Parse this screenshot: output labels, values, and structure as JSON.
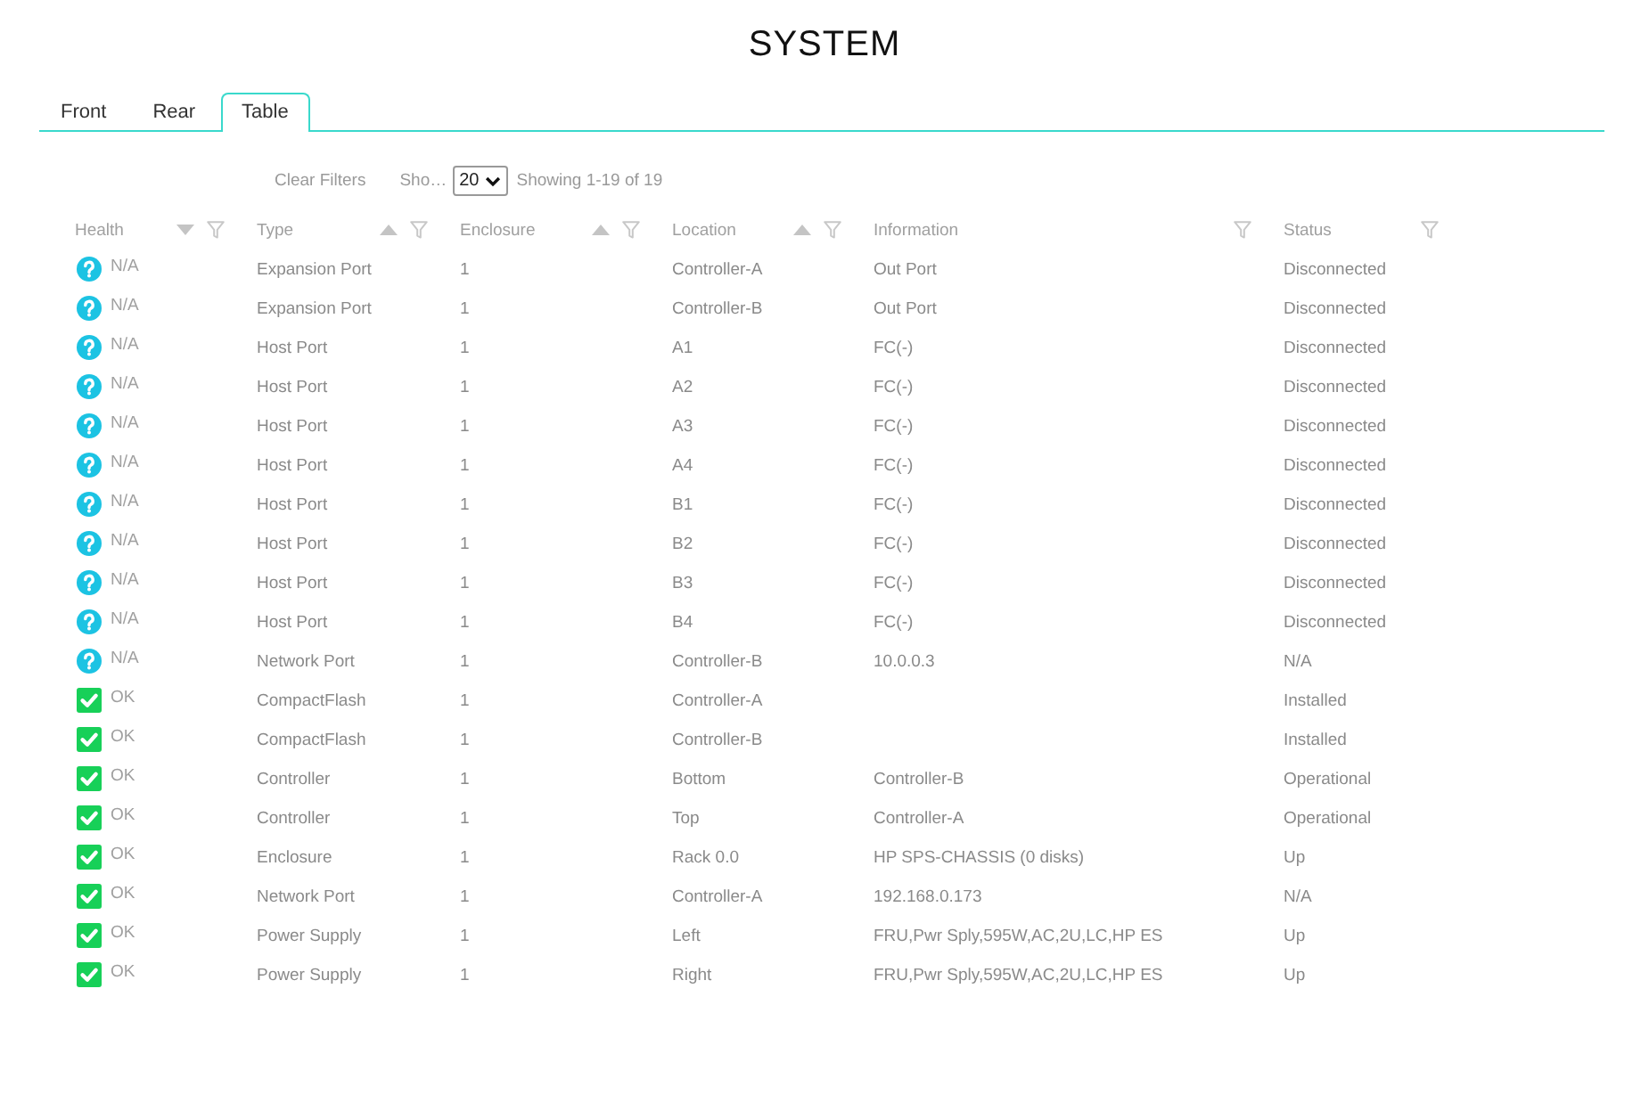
{
  "title": "SYSTEM",
  "tabs": [
    {
      "label": "Front",
      "selected": false
    },
    {
      "label": "Rear",
      "selected": false
    },
    {
      "label": "Table",
      "selected": true
    }
  ],
  "toolbar": {
    "clear_filters": {
      "label": "Clear Filters",
      "disabled": true
    },
    "page_size_label": "Sho…",
    "page_size": "20",
    "showing": "Showing 1-19 of 19"
  },
  "table": {
    "columns": [
      {
        "label": "Health",
        "sortable": true,
        "descending": true
      },
      {
        "label": "Type",
        "sortable": true,
        "descending": false
      },
      {
        "label": "Enclosure",
        "sortable": true,
        "descending": false
      },
      {
        "label": "Location",
        "sortable": true,
        "descending": false
      },
      {
        "label": "Information",
        "sortable": false
      },
      {
        "label": "Status",
        "sortable": false
      }
    ],
    "rows": [
      {
        "health": {
          "kind": "unknown",
          "label": "N/A"
        },
        "type": "Expansion Port",
        "enclosure": "1",
        "location": "Controller-A",
        "information": "Out Port",
        "status": "Disconnected"
      },
      {
        "health": {
          "kind": "unknown",
          "label": "N/A"
        },
        "type": "Expansion Port",
        "enclosure": "1",
        "location": "Controller-B",
        "information": "Out Port",
        "status": "Disconnected"
      },
      {
        "health": {
          "kind": "unknown",
          "label": "N/A"
        },
        "type": "Host Port",
        "enclosure": "1",
        "location": "A1",
        "information": "FC(-)",
        "status": "Disconnected"
      },
      {
        "health": {
          "kind": "unknown",
          "label": "N/A"
        },
        "type": "Host Port",
        "enclosure": "1",
        "location": "A2",
        "information": "FC(-)",
        "status": "Disconnected"
      },
      {
        "health": {
          "kind": "unknown",
          "label": "N/A"
        },
        "type": "Host Port",
        "enclosure": "1",
        "location": "A3",
        "information": "FC(-)",
        "status": "Disconnected"
      },
      {
        "health": {
          "kind": "unknown",
          "label": "N/A"
        },
        "type": "Host Port",
        "enclosure": "1",
        "location": "A4",
        "information": "FC(-)",
        "status": "Disconnected"
      },
      {
        "health": {
          "kind": "unknown",
          "label": "N/A"
        },
        "type": "Host Port",
        "enclosure": "1",
        "location": "B1",
        "information": "FC(-)",
        "status": "Disconnected"
      },
      {
        "health": {
          "kind": "unknown",
          "label": "N/A"
        },
        "type": "Host Port",
        "enclosure": "1",
        "location": "B2",
        "information": "FC(-)",
        "status": "Disconnected"
      },
      {
        "health": {
          "kind": "unknown",
          "label": "N/A"
        },
        "type": "Host Port",
        "enclosure": "1",
        "location": "B3",
        "information": "FC(-)",
        "status": "Disconnected"
      },
      {
        "health": {
          "kind": "unknown",
          "label": "N/A"
        },
        "type": "Host Port",
        "enclosure": "1",
        "location": "B4",
        "information": "FC(-)",
        "status": "Disconnected"
      },
      {
        "health": {
          "kind": "unknown",
          "label": "N/A"
        },
        "type": "Network Port",
        "enclosure": "1",
        "location": "Controller-B",
        "information": "10.0.0.3",
        "status": "N/A"
      },
      {
        "health": {
          "kind": "ok",
          "label": "OK"
        },
        "type": "CompactFlash",
        "enclosure": "1",
        "location": "Controller-A",
        "status": "Installed"
      },
      {
        "health": {
          "kind": "ok",
          "label": "OK"
        },
        "type": "CompactFlash",
        "enclosure": "1",
        "location": "Controller-B",
        "status": "Installed"
      },
      {
        "health": {
          "kind": "ok",
          "label": "OK"
        },
        "type": "Controller",
        "enclosure": "1",
        "location": "Bottom",
        "information": "Controller-B",
        "status": "Operational"
      },
      {
        "health": {
          "kind": "ok",
          "label": "OK"
        },
        "type": "Controller",
        "enclosure": "1",
        "location": "Top",
        "information": "Controller-A",
        "status": "Operational"
      },
      {
        "health": {
          "kind": "ok",
          "label": "OK"
        },
        "type": "Enclosure",
        "enclosure": "1",
        "location": "Rack 0.0",
        "information": "HP SPS-CHASSIS (0 disks)",
        "status": "Up"
      },
      {
        "health": {
          "kind": "ok",
          "label": "OK"
        },
        "type": "Network Port",
        "enclosure": "1",
        "location": "Controller-A",
        "information": "192.168.0.173",
        "status": "N/A"
      },
      {
        "health": {
          "kind": "ok",
          "label": "OK"
        },
        "type": "Power Supply",
        "enclosure": "1",
        "location": "Left",
        "information": "FRU,Pwr Sply,595W,AC,2U,LC,HP ES",
        "status": "Up"
      },
      {
        "health": {
          "kind": "ok",
          "label": "OK"
        },
        "type": "Power Supply",
        "enclosure": "1",
        "location": "Right",
        "information": "FRU,Pwr Sply,595W,AC,2U,LC,HP ES",
        "status": "Up"
      }
    ]
  }
}
